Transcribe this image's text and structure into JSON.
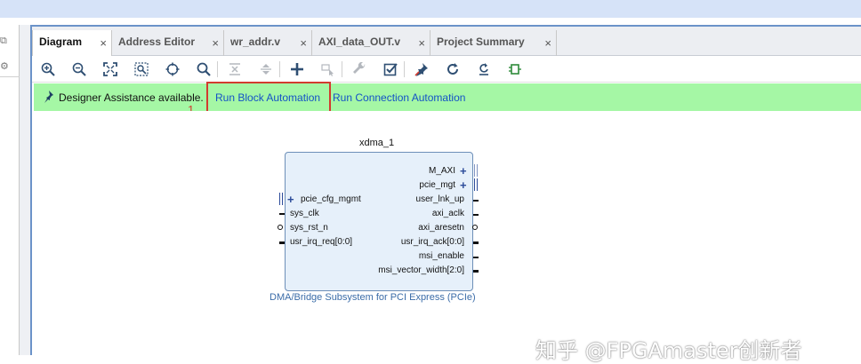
{
  "tabs": [
    {
      "label": "Diagram",
      "active": true
    },
    {
      "label": "Address Editor",
      "active": false
    },
    {
      "label": "wr_addr.v",
      "active": false
    },
    {
      "label": "AXI_data_OUT.v",
      "active": false
    },
    {
      "label": "Project Summary",
      "active": false
    }
  ],
  "tab_close_glyph": "×",
  "toolbar_icons": [
    "zoom-in-icon",
    "zoom-out-icon",
    "fit-icon",
    "zoom-area-icon",
    "auto-fit-selection-icon",
    "search-icon",
    "collapse-icon",
    "expand-icon",
    "add-ip-icon",
    "pointer-disabled-icon",
    "wrench-icon",
    "validate-icon",
    "pin-icon",
    "refresh-icon",
    "regenerate-icon",
    "layout-icon"
  ],
  "assistance": {
    "message": "Designer Assistance available.",
    "run_block_automation": "Run Block Automation",
    "run_connection_automation": "Run Connection Automation",
    "annotation_number": "1"
  },
  "block": {
    "name": "xdma_1",
    "subtitle": "DMA/Bridge Subsystem for PCI Express (PCIe)",
    "left_ports": [
      "pcie_cfg_mgmt",
      "sys_clk",
      "sys_rst_n",
      "usr_irq_req[0:0]"
    ],
    "right_ports": [
      "M_AXI",
      "pcie_mgt",
      "user_lnk_up",
      "axi_aclk",
      "axi_aresetn",
      "usr_irq_ack[0:0]",
      "msi_enable",
      "msi_vector_width[2:0]"
    ]
  },
  "watermark": "知乎 @FPGAmaster创新者",
  "colors": {
    "assist_bg": "#a5f7a5",
    "link": "#1452c7",
    "highlight": "#d23b2f",
    "block_fill": "#e6f0fa",
    "block_border": "#6d8fb8",
    "frame_border": "#6b93c9"
  }
}
